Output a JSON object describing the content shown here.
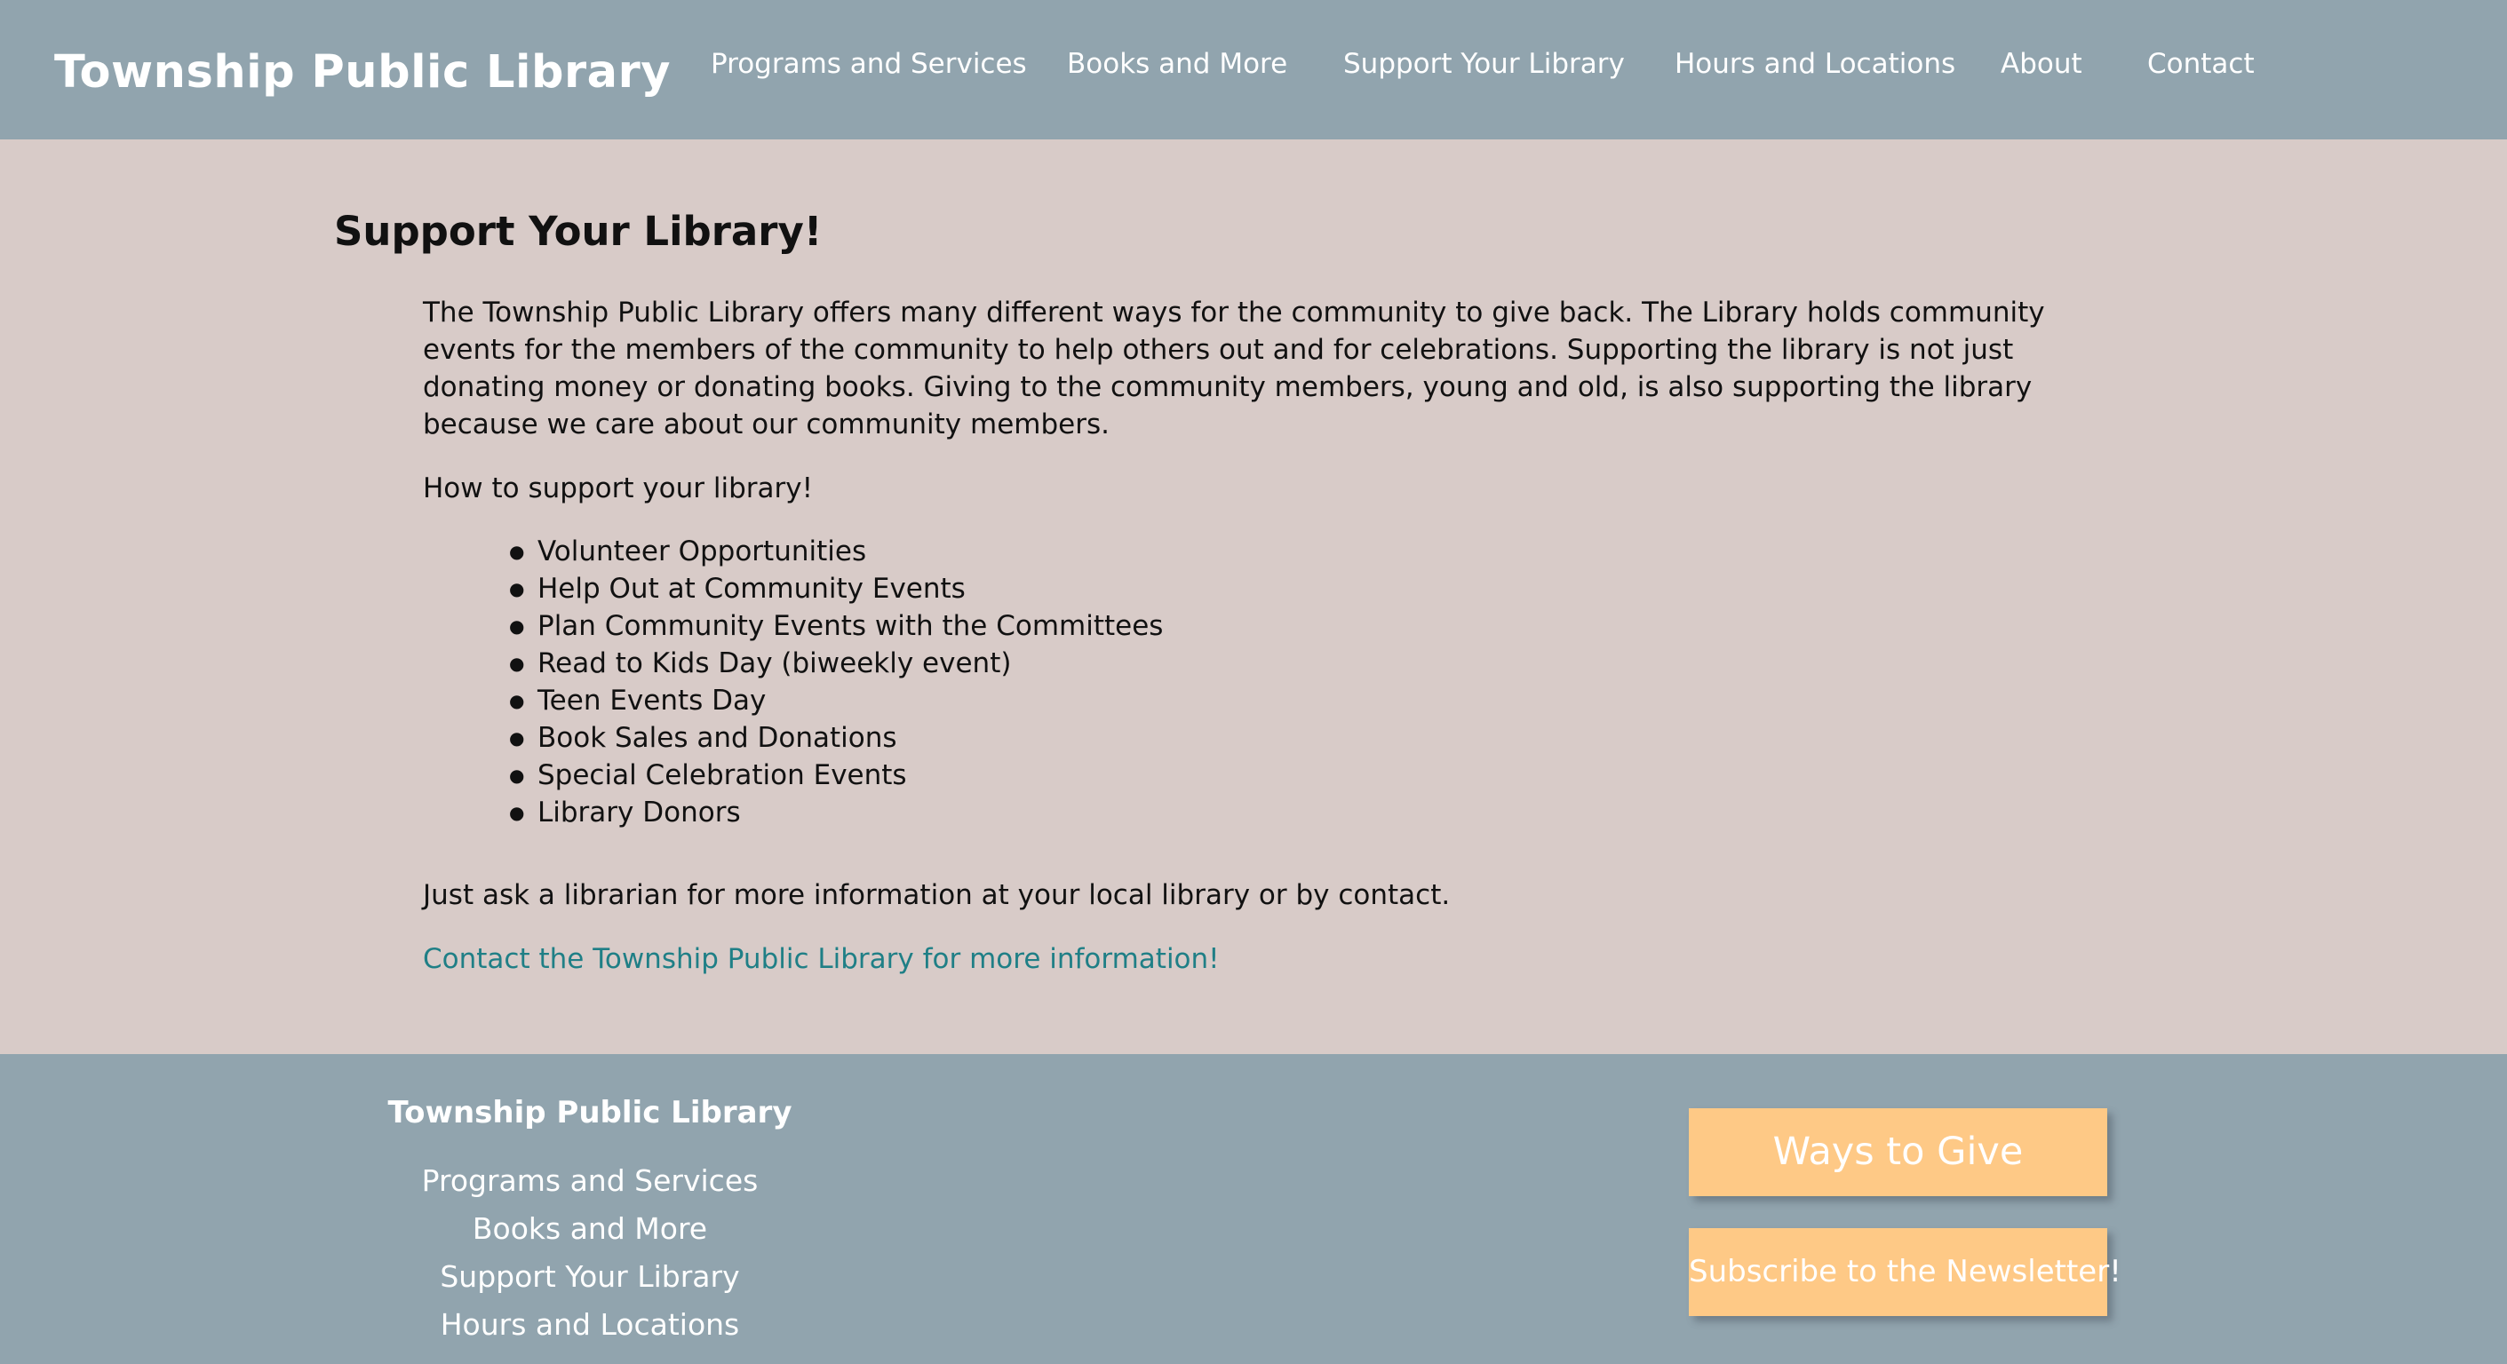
{
  "header": {
    "site_title": "Township Public Library",
    "nav": [
      "Programs and Services",
      "Books and More",
      "Support Your Library",
      "Hours and Locations",
      "About",
      "Contact"
    ]
  },
  "main": {
    "heading": "Support Your Library!",
    "intro": "The Township Public Library offers many different ways for the community to give back. The Library holds community events for the members of the community to help others out and for celebrations. Supporting the library is not just donating money or donating books. Giving to the community members, young and old, is also supporting the library because we care about our community members.",
    "how_to": "How to support your library!",
    "list": [
      "Volunteer Opportunities",
      "Help Out at Community Events",
      "Plan Community Events with the Committees",
      "Read to Kids Day (biweekly event)",
      "Teen Events Day",
      "Book Sales and Donations",
      "Special Celebration Events",
      "Library Donors"
    ],
    "ask_text": "Just ask a librarian for more information at your local library or by contact.",
    "contact_link": "Contact the Township Public Library for more information!"
  },
  "footer": {
    "title": "Township Public Library",
    "nav": [
      "Programs and Services",
      "Books and More",
      "Support Your Library",
      "Hours and Locations"
    ],
    "ways_to_give": "Ways to Give",
    "subscribe": "Subscribe to the Newsletter!"
  },
  "colors": {
    "header_bg": "#91a4ae",
    "page_bg": "#d8cbc8",
    "link": "#1f7f86",
    "cta_bg": "#fec986"
  }
}
